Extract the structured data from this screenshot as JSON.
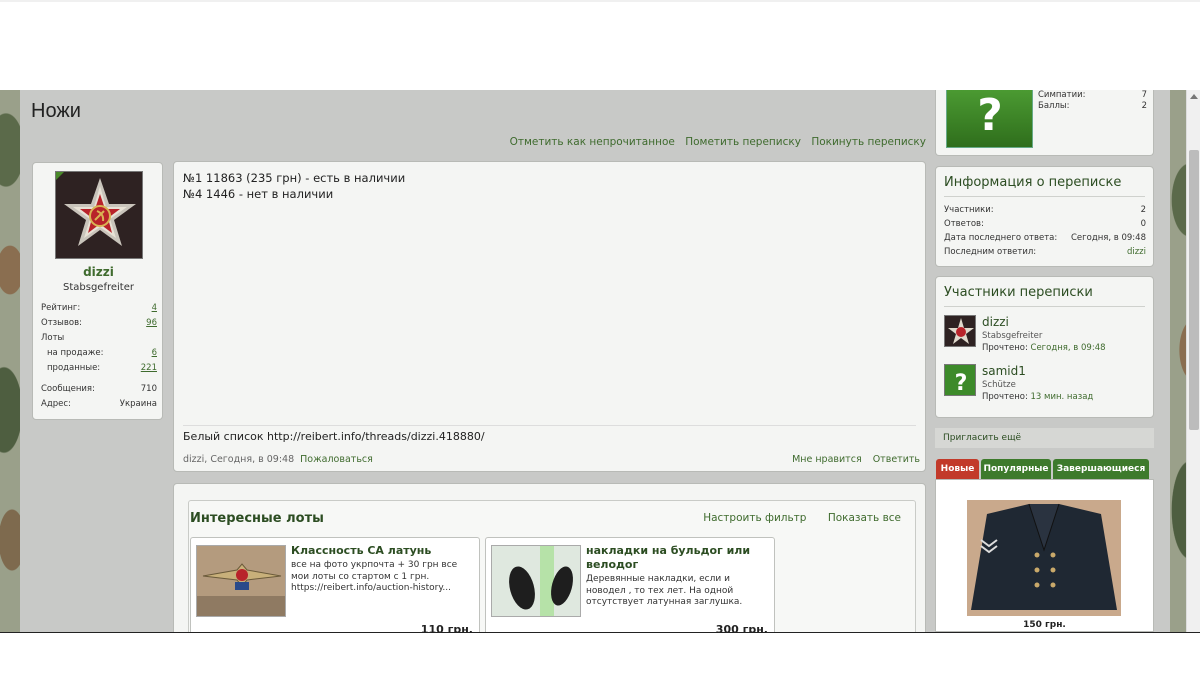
{
  "page": {
    "title": "Ножи"
  },
  "conversation_actions": [
    "Отметить как непрочитанное",
    "Пометить переписку",
    "Покинуть переписку"
  ],
  "author": {
    "name": "dizzi",
    "rank": "Stabsgefreiter",
    "stats": [
      {
        "label": "Рейтинг:",
        "value": "4",
        "link": true
      },
      {
        "label": "Отзывов:",
        "value": "96",
        "link": true
      },
      {
        "label": "Лоты",
        "value": "",
        "link": false
      },
      {
        "label": "на продаже:",
        "value": "6",
        "link": true
      },
      {
        "label": "проданные:",
        "value": "221",
        "link": true
      },
      {
        "label": "Сообщения:",
        "value": "710",
        "link": false
      },
      {
        "label": "Адрес:",
        "value": "Украина",
        "link": false
      }
    ]
  },
  "message": {
    "lines": [
      "№1 11863 (235 грн) - есть в наличии",
      "№4 1446 - нет в наличии"
    ],
    "signature": "Белый список http://reibert.info/threads/dizzi.418880/",
    "meta": "dizzi, Сегодня, в 09:48",
    "report": "Пожаловаться",
    "like": "Мне нравится",
    "reply": "Ответить"
  },
  "lots": {
    "title": "Интересные лоты",
    "filter": "Настроить фильтр",
    "show_all": "Показать все",
    "items": [
      {
        "title": "Классность СА латунь",
        "desc": "все на фото укрпочта + 30 грн все мои лоты со стартом с 1 грн. https://reibert.info/auction-history...",
        "price": "110 грн."
      },
      {
        "title": "накладки на бульдог или велодог",
        "desc": "Деревянные накладки, если и новодел , то тех лет. На одной отсутствует латунная заглушка.",
        "price": "300 грн."
      }
    ]
  },
  "badge": {
    "likes_label": "Симпатии:",
    "likes": "7",
    "points_label": "Баллы:",
    "points": "2"
  },
  "info": {
    "title": "Информация о переписке",
    "rows": [
      {
        "label": "Участники:",
        "value": "2"
      },
      {
        "label": "Ответов:",
        "value": "0"
      },
      {
        "label": "Дата последнего ответа:",
        "value": "Сегодня, в 09:48"
      },
      {
        "label": "Последним ответил:",
        "value": "dizzi"
      }
    ]
  },
  "participants": {
    "title": "Участники переписки",
    "list": [
      {
        "name": "dizzi",
        "rank": "Stabsgefreiter",
        "read_label": "Прочтено:",
        "read": "Сегодня, в 09:48"
      },
      {
        "name": "samid1",
        "rank": "Schütze",
        "read_label": "Прочтено:",
        "read": "13 мин. назад"
      }
    ]
  },
  "invite": "Пригласить ещё",
  "tabs": [
    "Новые",
    "Популярные",
    "Завершающиеся"
  ],
  "featured": {
    "price": "150 грн."
  },
  "colors": {
    "accent_green": "#3f6b2e",
    "tab_red": "#c23a2a",
    "tab_green": "#3d7a2c"
  }
}
